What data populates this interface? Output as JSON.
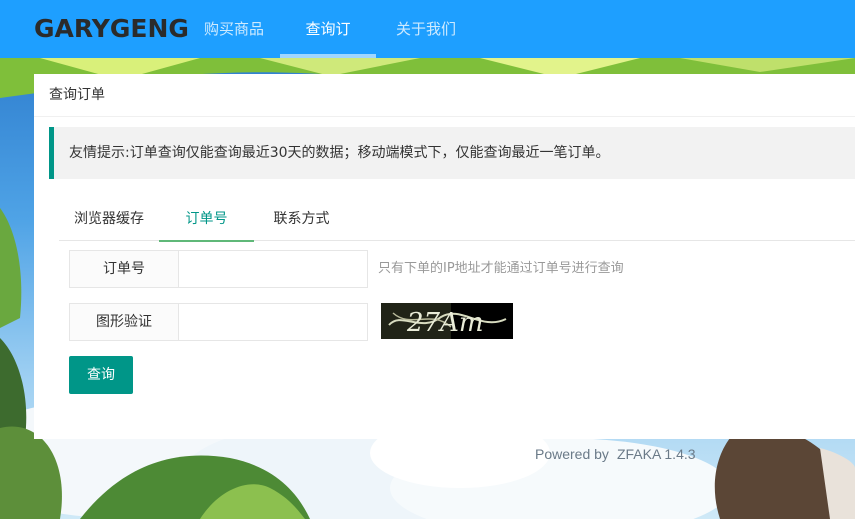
{
  "header": {
    "logo": "GARYGENG",
    "nav": [
      {
        "label": "购买商品"
      },
      {
        "label": "查询订单"
      },
      {
        "label": "关于我们"
      }
    ]
  },
  "card": {
    "title": "查询订单",
    "notice": "友情提示:订单查询仅能查询最近30天的数据；移动端模式下，仅能查询最近一笔订单。",
    "tabs": [
      {
        "label": "浏览器缓存"
      },
      {
        "label": "订单号"
      },
      {
        "label": "联系方式"
      }
    ],
    "order_field": {
      "label": "订单号",
      "value": "",
      "placeholder": "",
      "hint": "只有下单的IP地址才能通过订单号进行查询"
    },
    "captcha_field": {
      "label": "图形验证",
      "value": "",
      "placeholder": "",
      "captcha_text": "27Am"
    },
    "submit_label": "查询"
  },
  "footer": {
    "powered_by": "Powered by",
    "brand": "ZFAKA 1.4.3"
  },
  "colors": {
    "header_bg": "#1e9fff",
    "accent": "#009688",
    "tab_underline": "#5FB878"
  }
}
